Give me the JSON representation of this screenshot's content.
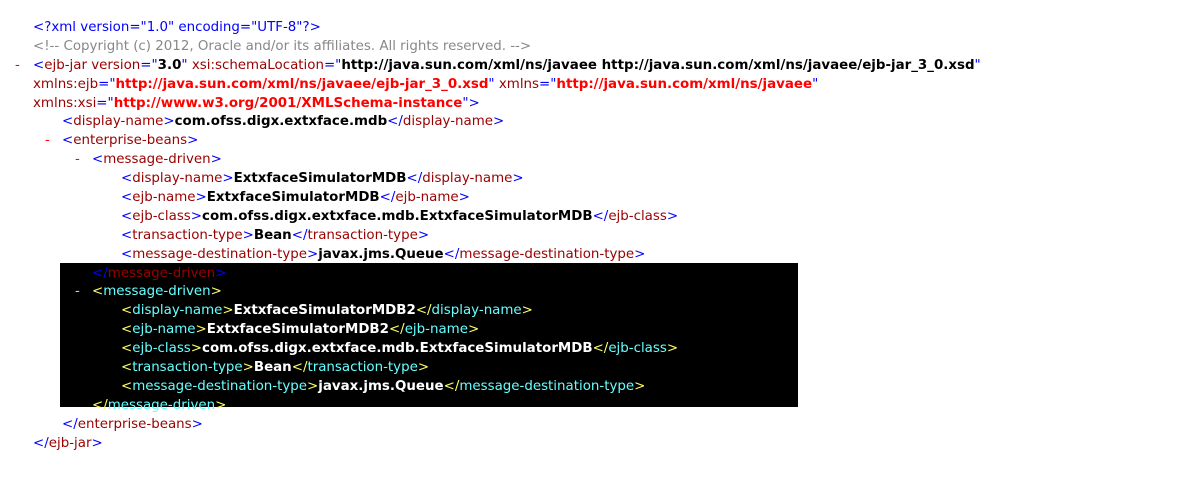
{
  "xml_declaration": "<?xml version=\"1.0\" encoding=\"UTF-8\"?>",
  "comment": "<!-- Copyright (c) 2012, Oracle and/or its affiliates. All rights reserved. -->",
  "collapse_symbol": "-",
  "root": {
    "tag": "ejb-jar",
    "attrs": {
      "version_name": "version",
      "version_value": "3.0",
      "schema_name": "xsi:schemaLocation",
      "schema_value": "http://java.sun.com/xml/ns/javaee http://java.sun.com/xml/ns/javaee/ejb-jar_3_0.xsd",
      "xmlns_ejb_name": "xmlns:ejb",
      "xmlns_ejb_value": "http://java.sun.com/xml/ns/javaee/ejb-jar_3_0.xsd",
      "xmlns_name": "xmlns",
      "xmlns_value": "http://java.sun.com/xml/ns/javaee",
      "xmlns_xsi_name": "xmlns:xsi",
      "xmlns_xsi_value": "http://www.w3.org/2001/XMLSchema-instance"
    },
    "display_name_tag": "display-name",
    "display_name": "com.ofss.digx.extxface.mdb",
    "enterprise_beans_tag": "enterprise-beans",
    "message_driven_tag": "message-driven",
    "beans": [
      {
        "display_name_tag": "display-name",
        "display_name": "ExtxfaceSimulatorMDB",
        "ejb_name_tag": "ejb-name",
        "ejb_name": "ExtxfaceSimulatorMDB",
        "ejb_class_tag": "ejb-class",
        "ejb_class": "com.ofss.digx.extxface.mdb.ExtxfaceSimulatorMDB",
        "transaction_type_tag": "transaction-type",
        "transaction_type": "Bean",
        "destination_type_tag": "message-destination-type",
        "destination_type": "javax.jms.Queue"
      },
      {
        "display_name_tag": "display-name",
        "display_name": "ExtxfaceSimulatorMDB2",
        "ejb_name_tag": "ejb-name",
        "ejb_name": "ExtxfaceSimulatorMDB2",
        "ejb_class_tag": "ejb-class",
        "ejb_class": "com.ofss.digx.extxface.mdb.ExtxfaceSimulatorMDB",
        "transaction_type_tag": "transaction-type",
        "transaction_type": "Bean",
        "destination_type_tag": "message-destination-type",
        "destination_type": "javax.jms.Queue"
      }
    ]
  },
  "colors": {
    "bracket": "#0000ff",
    "tag_name": "#990000",
    "namespace_value": "#ff0000",
    "comment": "#888888",
    "selection_background": "#000000"
  }
}
